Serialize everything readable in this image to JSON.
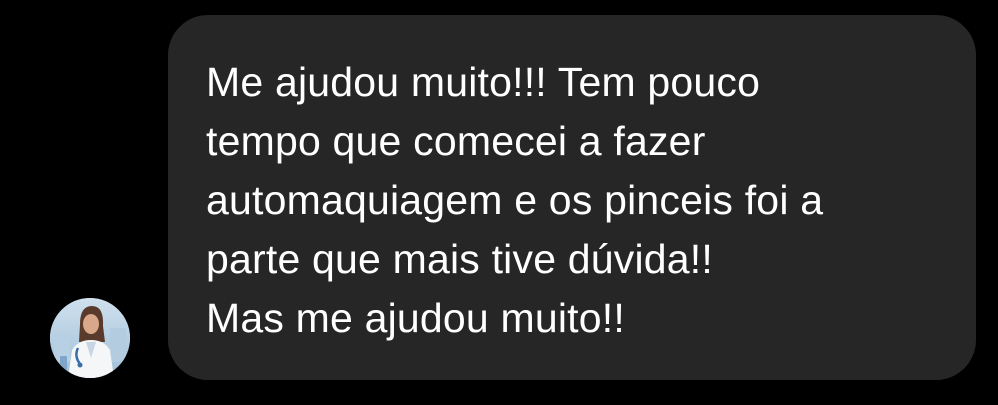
{
  "colors": {
    "background": "#000000",
    "bubble": "#262626",
    "text": "#ffffff"
  },
  "message": {
    "lines": [
      "Me ajudou muito!!! Tem pouco",
      "tempo que comecei a fazer",
      "automaquiagem e os pinceis foi a",
      "parte que mais tive dúvida!!",
      "Mas me ajudou muito!!"
    ]
  },
  "sender": {
    "avatar_icon": "profile-photo"
  }
}
